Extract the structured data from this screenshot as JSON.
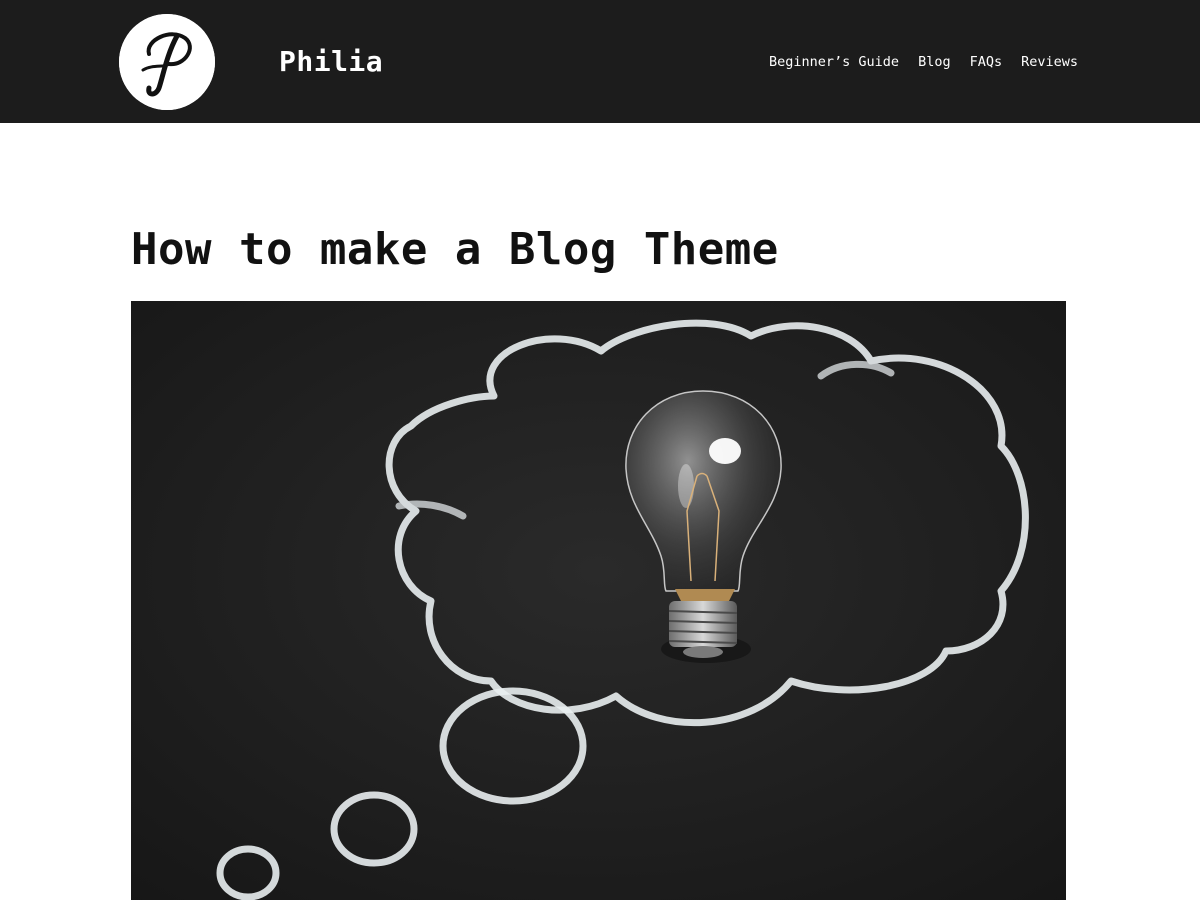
{
  "header": {
    "logo_icon": "script-p-logo-icon",
    "site_title": "Philia",
    "nav": [
      {
        "label": "Beginner’s Guide"
      },
      {
        "label": "Blog"
      },
      {
        "label": "FAQs"
      },
      {
        "label": "Reviews"
      }
    ]
  },
  "post": {
    "title": "How to make a Blog Theme",
    "hero_image_icon": "chalkboard-thought-bubble-lightbulb"
  },
  "colors": {
    "header_bg": "#1c1c1c",
    "header_text": "#ffffff",
    "page_bg": "#ffffff",
    "title_text": "#111111",
    "chalkboard": "#1e1e1e",
    "chalk": "#e9eef0"
  }
}
